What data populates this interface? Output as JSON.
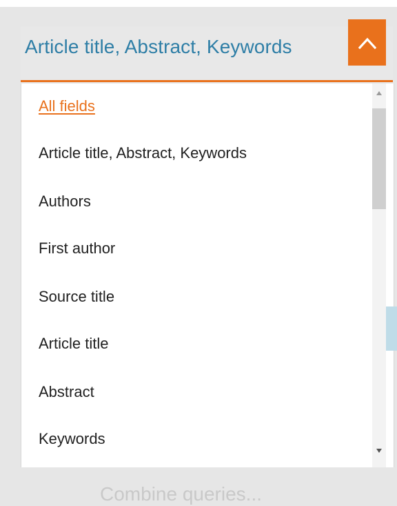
{
  "dropdown": {
    "selected_label": "Article title, Abstract, Keywords",
    "toggle_icon": "chevron-up-icon",
    "options": [
      {
        "label": "All fields",
        "active": true
      },
      {
        "label": "Article title, Abstract, Keywords",
        "active": false
      },
      {
        "label": "Authors",
        "active": false
      },
      {
        "label": "First author",
        "active": false
      },
      {
        "label": "Source title",
        "active": false
      },
      {
        "label": "Article title",
        "active": false
      },
      {
        "label": "Abstract",
        "active": false
      },
      {
        "label": "Keywords",
        "active": false
      }
    ]
  },
  "footer": {
    "combine_label": "Combine queries..."
  },
  "colors": {
    "accent": "#e9711c",
    "title_blue": "#2e7ea6",
    "background": "#e6e6e6"
  }
}
